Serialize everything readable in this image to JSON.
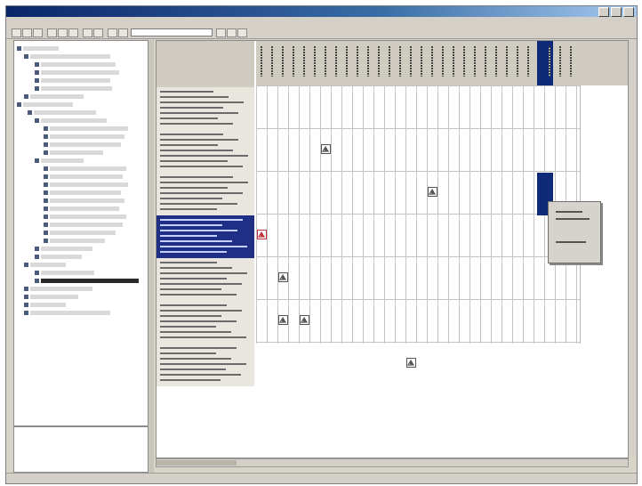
{
  "window": {
    "title": ""
  },
  "menu": [],
  "status": {
    "left": "",
    "right": ""
  },
  "grid": {
    "selected_row": 3,
    "selected_column": 26,
    "marks": [
      {
        "row": 1,
        "col": 6
      },
      {
        "row": 2,
        "col": 16
      },
      {
        "row": 3,
        "col": 0
      },
      {
        "row": 4,
        "col": 2
      },
      {
        "row": 5,
        "col": 2
      },
      {
        "row": 5,
        "col": 4
      },
      {
        "row": 6,
        "col": 14
      }
    ]
  },
  "colors": {
    "selection": "#1f2f86",
    "mark": "#555555",
    "mark_selected": "#c0303a"
  },
  "icons": {
    "mark": "dependency-mark-icon"
  }
}
